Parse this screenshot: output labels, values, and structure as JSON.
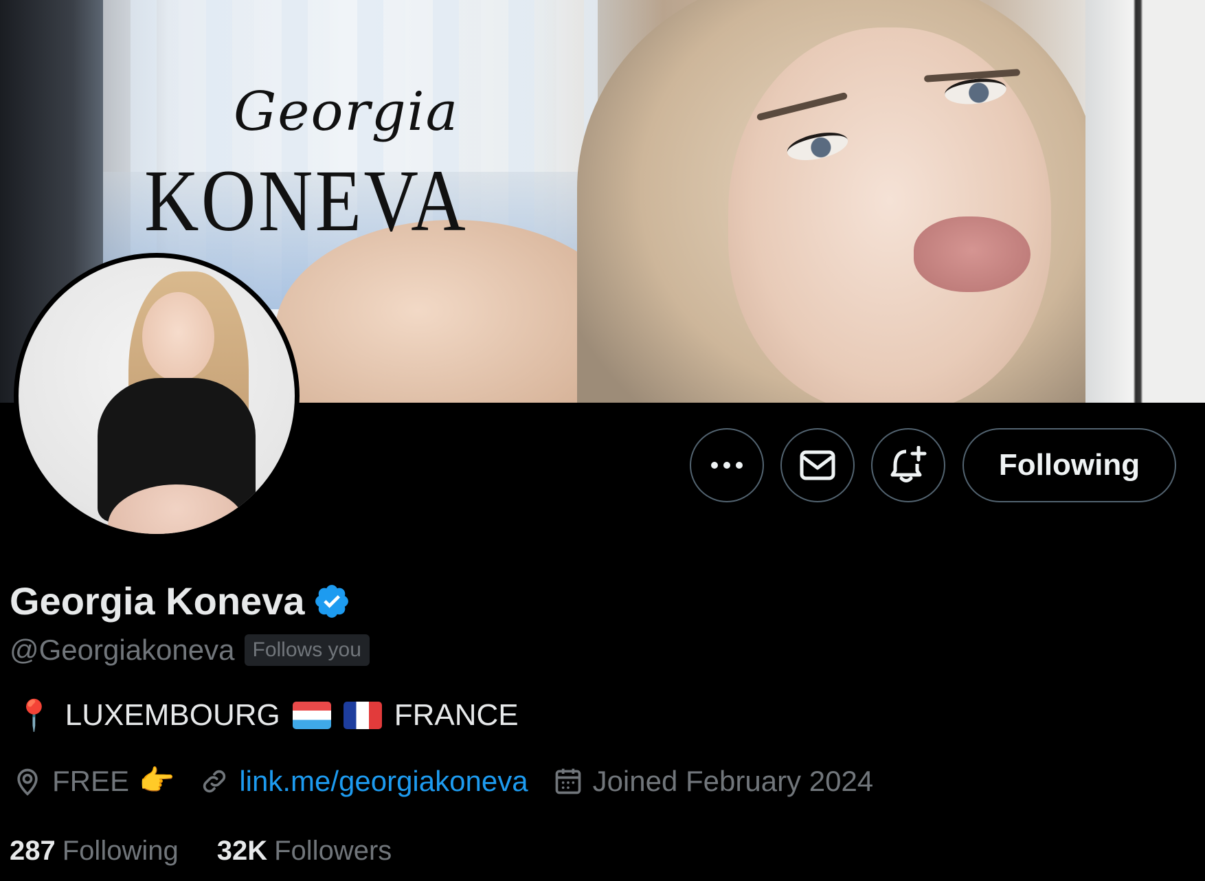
{
  "banner": {
    "logo_script": "Georgia",
    "logo_word": "KONEVA"
  },
  "actions": {
    "more_label": "More",
    "message_label": "Message",
    "notify_label": "Turn on notifications",
    "follow_label": "Following"
  },
  "profile": {
    "display_name": "Georgia Koneva",
    "verified": true,
    "handle": "@Georgiakoneva",
    "follows_you": "Follows you",
    "bio": {
      "pin": "📍",
      "part1": "LUXEMBOURG",
      "flag1": "Luxembourg flag",
      "flag2": "France flag",
      "part2": "FRANCE"
    },
    "location": "FREE",
    "location_emoji": "👉",
    "link": "link.me/georgiakoneva",
    "joined": "Joined February 2024"
  },
  "stats": {
    "following_count": "287",
    "following_label": "Following",
    "followers_count": "32K",
    "followers_label": "Followers"
  },
  "colors": {
    "accent": "#1d9bf0",
    "muted": "#71767b",
    "border": "#536471",
    "background": "#000000"
  }
}
